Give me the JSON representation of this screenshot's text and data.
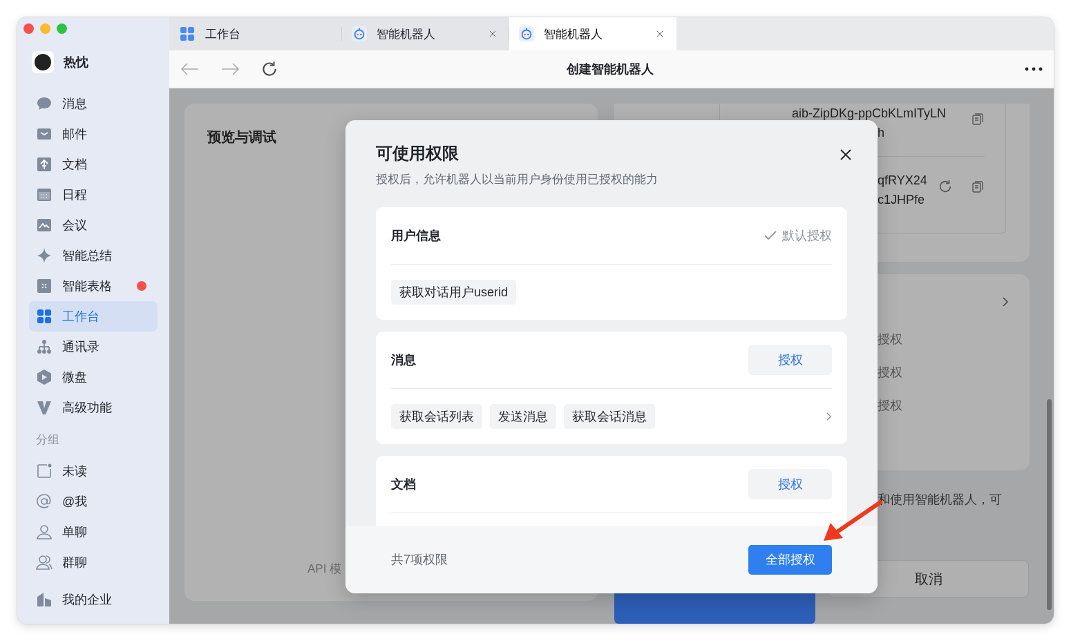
{
  "profile": {
    "name": "热忱"
  },
  "sidebar": {
    "items": [
      {
        "label": "消息",
        "selected": false,
        "dot": false
      },
      {
        "label": "邮件",
        "selected": false,
        "dot": false
      },
      {
        "label": "文档",
        "selected": false,
        "dot": false
      },
      {
        "label": "日程",
        "selected": false,
        "dot": false
      },
      {
        "label": "会议",
        "selected": false,
        "dot": false
      },
      {
        "label": "智能总结",
        "selected": false,
        "dot": false
      },
      {
        "label": "智能表格",
        "selected": false,
        "dot": true
      },
      {
        "label": "工作台",
        "selected": true,
        "dot": false
      },
      {
        "label": "通讯录",
        "selected": false,
        "dot": false
      },
      {
        "label": "微盘",
        "selected": false,
        "dot": false
      },
      {
        "label": "高级功能",
        "selected": false,
        "dot": false
      }
    ],
    "group_title": "分组",
    "group_items": [
      {
        "label": "未读",
        "selected": false
      },
      {
        "label": "@我",
        "selected": false
      },
      {
        "label": "单聊",
        "selected": false
      },
      {
        "label": "群聊",
        "selected": false
      }
    ],
    "footer_item": {
      "label": "我的企业"
    }
  },
  "tabs": [
    {
      "label": "工作台",
      "closable": false,
      "selected": false
    },
    {
      "label": "智能机器人",
      "closable": true,
      "selected": false
    },
    {
      "label": "智能机器人",
      "closable": true,
      "selected": true
    }
  ],
  "toolbar": {
    "title": "创建智能机器人"
  },
  "background": {
    "preview_title": "预览与调试",
    "api_text": "API 模",
    "credentials": [
      {
        "lines": [
          "aib-ZipDKg-ppCbKLmITyLN",
          "h"
        ],
        "refreshable": false
      },
      {
        "lines": [
          "qfRYX24",
          "c1JHPfe"
        ],
        "refreshable": true
      }
    ],
    "permission_rows": [
      "授权",
      "授权",
      "授权"
    ],
    "note": "和使用智能机器人，可",
    "cancel_button": "取消"
  },
  "dialog": {
    "title": "可使用权限",
    "subtitle": "授权后，允许机器人以当前用户身份使用已授权的能力",
    "sections": [
      {
        "title": "用户信息",
        "kind": "default",
        "status": "默认授权",
        "tags": [
          "获取对话用户userid"
        ],
        "has_more": false
      },
      {
        "title": "消息",
        "kind": "button",
        "button": "授权",
        "tags": [
          "获取会话列表",
          "发送消息",
          "获取会话消息"
        ],
        "has_more": true
      },
      {
        "title": "文档",
        "kind": "button",
        "button": "授权",
        "has_more": false
      }
    ],
    "footer_text": "共7项权限",
    "primary_button": "全部授权"
  }
}
